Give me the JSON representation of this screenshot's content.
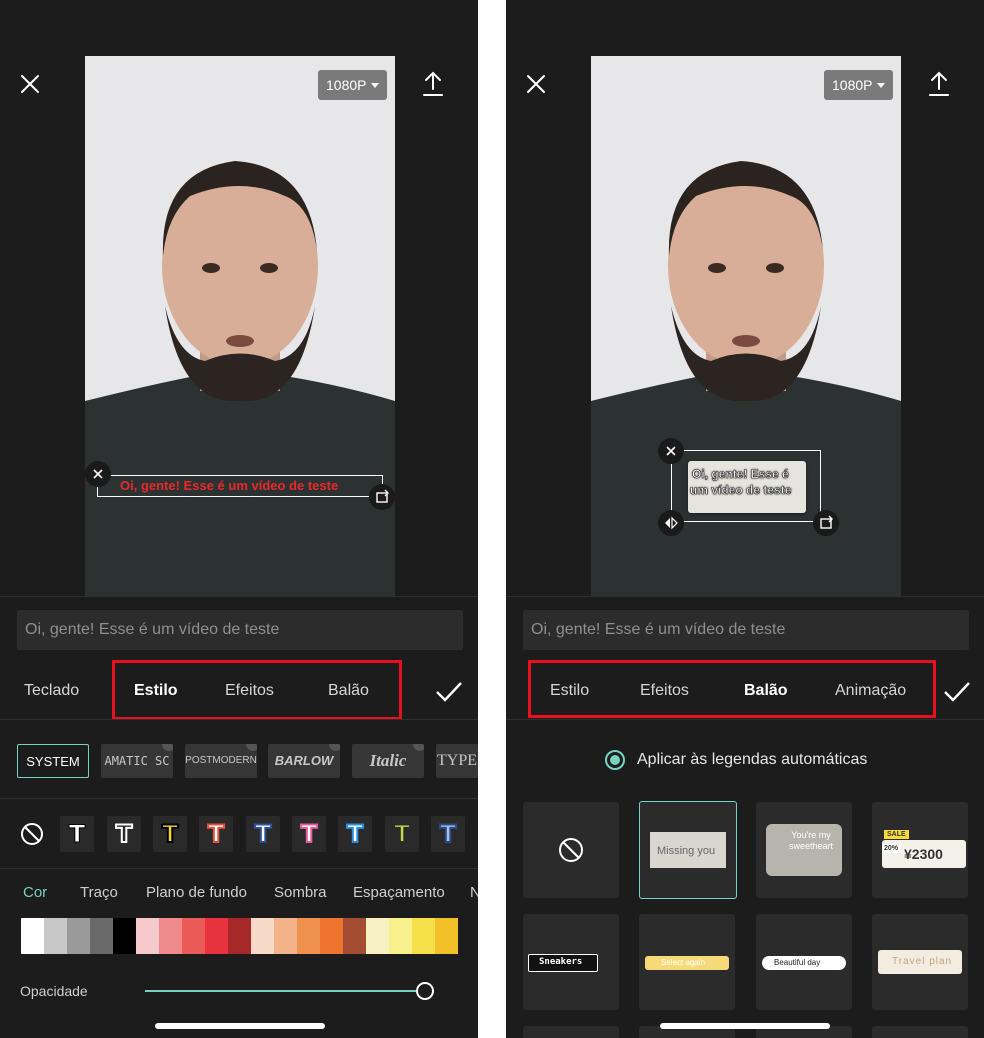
{
  "left": {
    "resolution": "1080P",
    "caption": "Oi, gente! Esse é um vídeo de teste",
    "input_value": "Oi, gente! Esse é um vídeo de teste",
    "tabs": [
      "Teclado",
      "Estilo",
      "Efeitos",
      "Balão"
    ],
    "active_tab": "Estilo",
    "fonts": [
      "SYSTEM",
      "AMATIC SC",
      "POSTMODERN",
      "BARLOW",
      "Italic",
      "TYPE"
    ],
    "selected_font": "SYSTEM",
    "text_style_glyph": "T",
    "subtabs": [
      "Cor",
      "Traço",
      "Plano de fundo",
      "Sombra",
      "Espaçamento",
      "N"
    ],
    "active_subtab": "Cor",
    "palette": [
      "#ffffff",
      "#c8c8c8",
      "#9a9a9a",
      "#6a6a6a",
      "#000000",
      "#f6c9cc",
      "#ef8a8a",
      "#ea5a57",
      "#e8323d",
      "#a62828",
      "#f6d9c7",
      "#f2b28a",
      "#f0924f",
      "#ee7430",
      "#a54d33",
      "#f7f2c6",
      "#f8f08c",
      "#f6e04a",
      "#f2c12a"
    ],
    "opacity_label": "Opacidade",
    "opacity_value": 1.0
  },
  "right": {
    "resolution": "1080P",
    "caption_line1": "Oi, gente! Esse é",
    "caption_line2": "um vídeo de teste",
    "input_value": "Oi, gente! Esse é um vídeo de teste",
    "tabs": [
      "Estilo",
      "Efeitos",
      "Balão",
      "Animação"
    ],
    "active_tab": "Balão",
    "auto_caption_label": "Aplicar às legendas automáticas",
    "bubbles": [
      {
        "label": ""
      },
      {
        "label": "Missing you"
      },
      {
        "label": "You're my sweetheart"
      },
      {
        "label": "¥2300",
        "badge": "SALE",
        "badge2": "20%"
      },
      {
        "label": "Sneakers"
      },
      {
        "label": "Select again"
      },
      {
        "label": "Beautiful day"
      },
      {
        "label": "Travel plan"
      }
    ]
  },
  "colors": {
    "accent": "#78d2c0",
    "highlight": "#e8101e",
    "background": "#1c1c1c"
  }
}
